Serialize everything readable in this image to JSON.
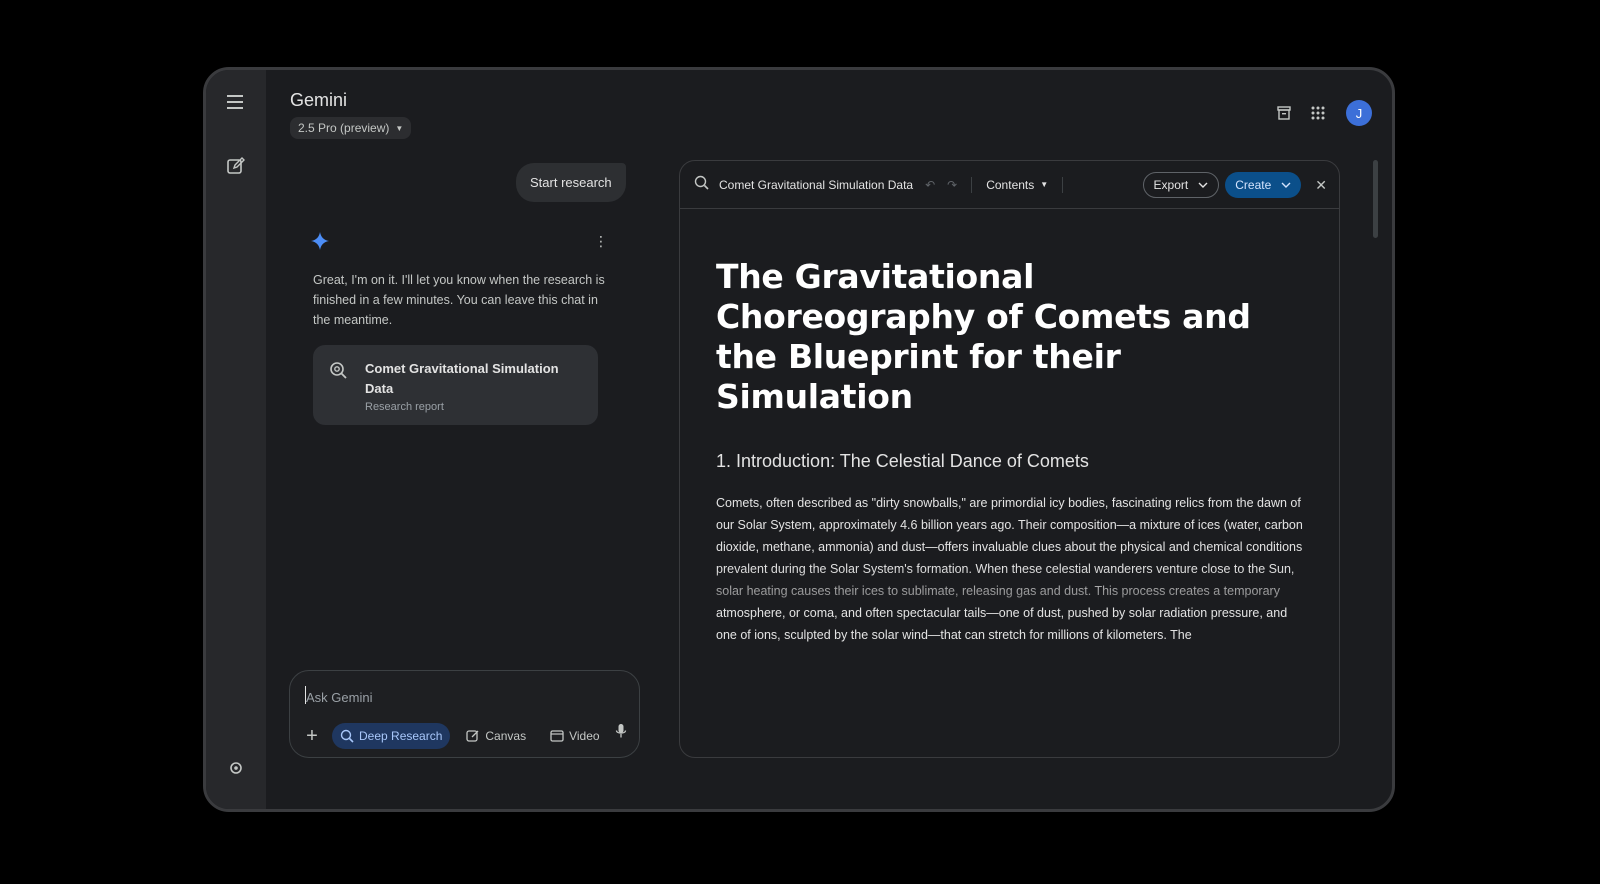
{
  "app": {
    "title": "Gemini",
    "model": "2.5 Pro (preview)",
    "avatar_initial": "J",
    "accent_color": "#3c6fd8"
  },
  "rail": {
    "icons": [
      "menu-icon",
      "new-chat-icon",
      "settings-icon"
    ]
  },
  "header_icons": [
    "archive-icon",
    "apps-grid-icon"
  ],
  "chat": {
    "user_message": "Start research",
    "reply": "Great, I'm on it. I'll let you know when the research is finished in a few minutes. You can leave this chat in the meantime.",
    "report_card": {
      "title": "Comet Gravitational Simulation Data",
      "subtitle": "Research report"
    }
  },
  "composer": {
    "placeholder": "Ask Gemini",
    "tools": {
      "deep_research": "Deep Research",
      "canvas": "Canvas",
      "video": "Video"
    }
  },
  "canvas": {
    "doc_title": "Comet Gravitational Simulation Data",
    "contents_label": "Contents",
    "export_label": "Export",
    "create_label": "Create",
    "heading": "The Gravitational Choreography of Comets and the Blueprint for their Simulation",
    "section_title": "1. Introduction: The Celestial Dance of Comets",
    "paragraph": "Comets, often described as \"dirty snowballs,\" are primordial icy bodies, fascinating relics from the dawn of our Solar System, approximately 4.6 billion years ago. Their composition—a mixture of ices (water, carbon dioxide, methane, ammonia) and dust—offers invaluable clues about the physical and chemical conditions prevalent during the Solar System's formation. When these celestial wanderers venture close to the Sun, solar heating causes their ices to sublimate, releasing gas and dust. This process creates a temporary atmosphere, or coma, and often spectacular tails—one of dust, pushed by solar radiation pressure, and one of ions, sculpted by the solar wind—that can stretch for millions of kilometers. The"
  }
}
